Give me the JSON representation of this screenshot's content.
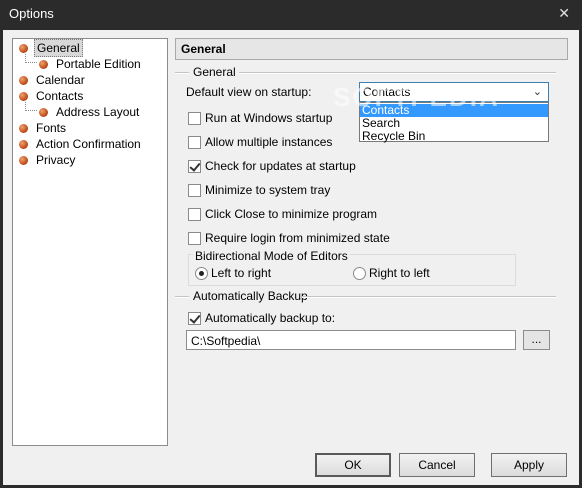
{
  "window": {
    "title": "Options",
    "close_glyph": "✕"
  },
  "tree": {
    "items": [
      {
        "label": "General",
        "level": 0,
        "selected": true
      },
      {
        "label": "Portable Edition",
        "level": 1
      },
      {
        "label": "Calendar",
        "level": 0
      },
      {
        "label": "Contacts",
        "level": 0
      },
      {
        "label": "Address Layout",
        "level": 1
      },
      {
        "label": "Fonts",
        "level": 0
      },
      {
        "label": "Action Confirmation",
        "level": 0
      },
      {
        "label": "Privacy",
        "level": 0
      }
    ]
  },
  "panel": {
    "header": "General",
    "general_group": "General",
    "default_view_label": "Default view on startup:",
    "default_view_value": "Contacts",
    "default_view_options": [
      "Contacts",
      "Search",
      "Recycle Bin"
    ],
    "checkboxes": [
      {
        "label": "Run at Windows startup",
        "checked": false
      },
      {
        "label": "Allow multiple instances",
        "checked": false
      },
      {
        "label": "Check for updates at startup",
        "checked": true
      },
      {
        "label": "Minimize to system tray",
        "checked": false
      },
      {
        "label": "Click Close to minimize program",
        "checked": false
      },
      {
        "label": "Require login from minimized state",
        "checked": false
      }
    ],
    "bidi_title": "Bidirectional Mode of Editors",
    "bidi_ltr": "Left to right",
    "bidi_rtl": "Right to left",
    "backup_group": "Automatically Backup",
    "backup_checkbox": "Automatically backup to:",
    "backup_path": "C:\\Softpedia\\",
    "browse_label": "..."
  },
  "buttons": {
    "ok": "OK",
    "cancel": "Cancel",
    "apply": "Apply"
  },
  "watermark": "SOFTPEDIA",
  "colors": {
    "titlebar_bg": "#2b2b2b",
    "client_bg": "#f0f0f0",
    "select_border": "#3c7fb1",
    "highlight": "#3399ff",
    "bullet": "#c0501e"
  },
  "icons": {
    "tree_bullet": "orange-bullet-icon",
    "dropdown": "chevron-down-icon",
    "close": "close-icon"
  }
}
